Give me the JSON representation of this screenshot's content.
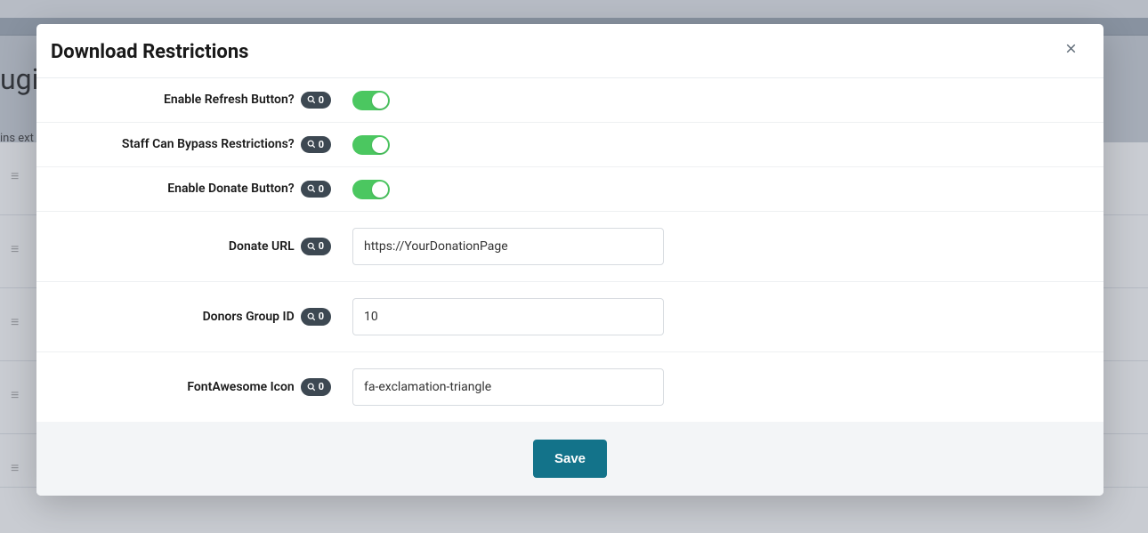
{
  "background": {
    "page_title_fragment": "ugin",
    "subtitle_fragment": "ins ext",
    "link": "https://ipbmafia.ru/"
  },
  "modal": {
    "title": "Download Restrictions",
    "badge_count": "0",
    "rows": {
      "refresh": {
        "label": "Enable Refresh Button?"
      },
      "staff_bypass": {
        "label": "Staff Can Bypass Restrictions?"
      },
      "donate_btn": {
        "label": "Enable Donate Button?"
      },
      "donate_url": {
        "label": "Donate URL",
        "value": "https://YourDonationPage"
      },
      "donors_group": {
        "label": "Donors Group ID",
        "value": "10"
      },
      "fa_icon": {
        "label": "FontAwesome Icon",
        "value": "fa-exclamation-triangle"
      }
    },
    "save_label": "Save"
  }
}
